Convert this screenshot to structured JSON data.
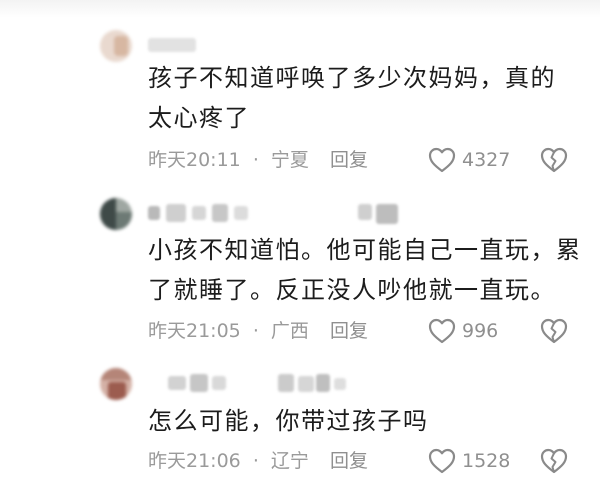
{
  "comments": [
    {
      "text": "孩子不知道呼唤了多少次妈妈，真的太心疼了",
      "time": "昨天20:11",
      "location": "宁夏",
      "reply_label": "回复",
      "likes": "4327"
    },
    {
      "text": "小孩不知道怕。他可能自己一直玩，累了就睡了。反正没人吵他就一直玩。",
      "time": "昨天21:05",
      "location": "广西",
      "reply_label": "回复",
      "likes": "996"
    },
    {
      "text": "怎么可能，你带过孩子吗",
      "time": "昨天21:06",
      "location": "辽宁",
      "reply_label": "回复",
      "likes": "1528"
    }
  ],
  "separator": "·",
  "icons": {
    "like": "heart-outline-icon",
    "dislike": "broken-heart-icon"
  },
  "colors": {
    "text": "#1c1c1c",
    "meta": "#9a9a9a",
    "icon": "#8a8a8a"
  }
}
